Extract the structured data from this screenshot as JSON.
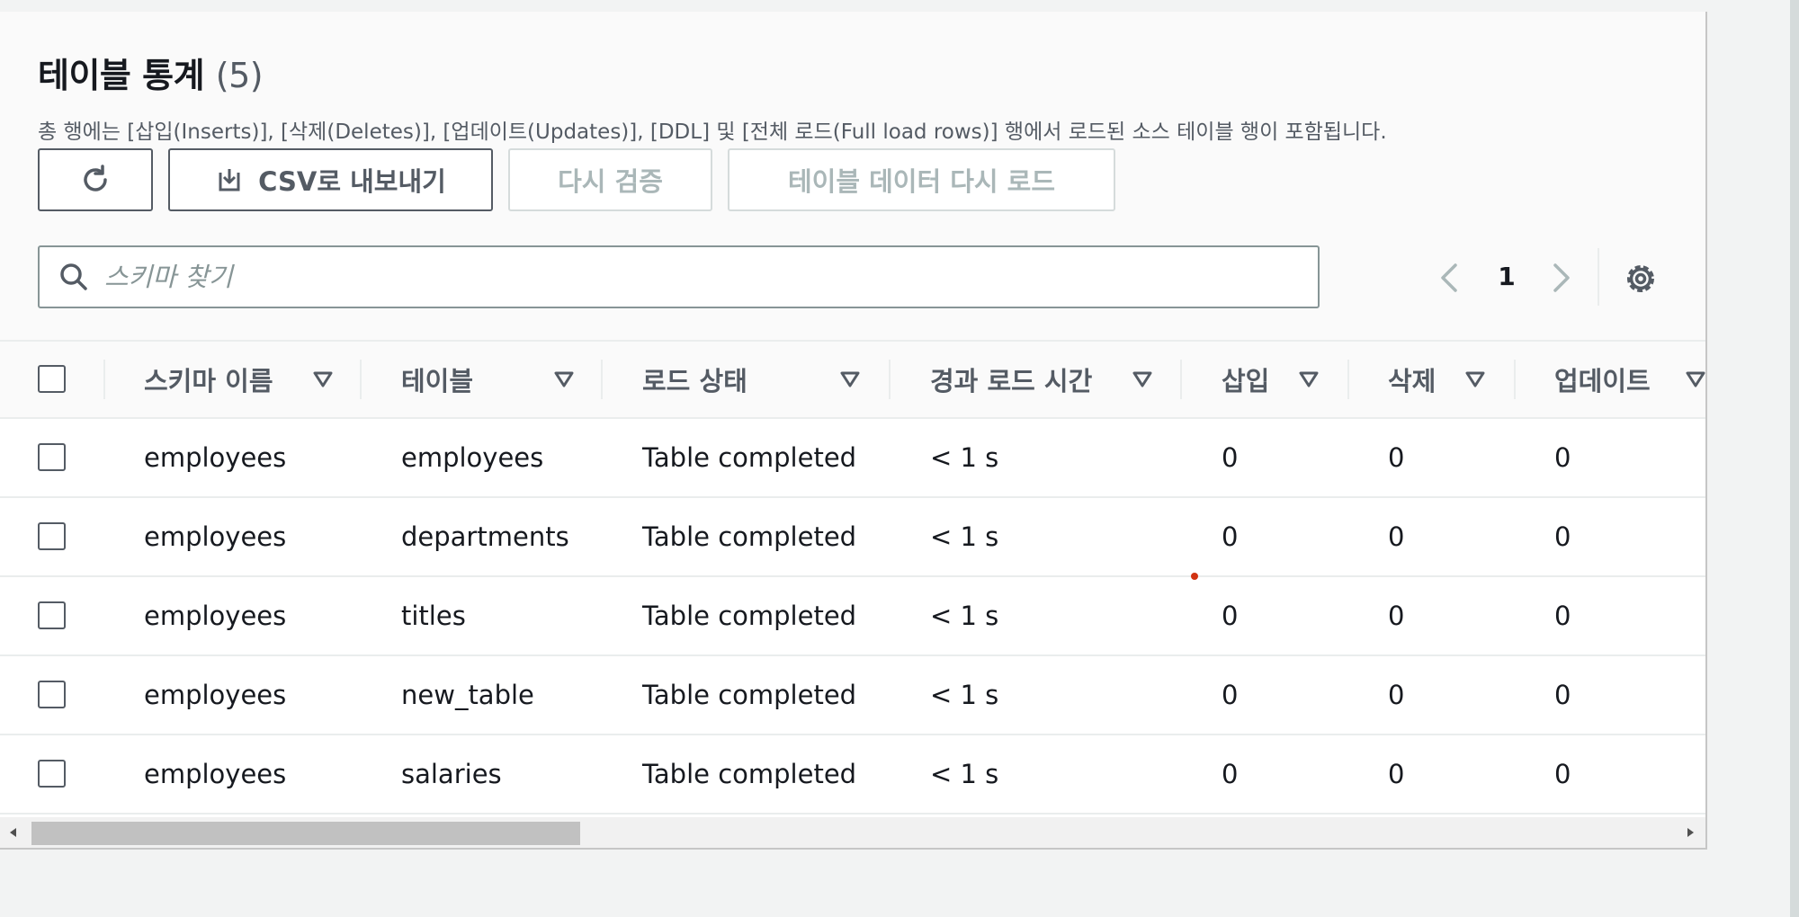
{
  "panel": {
    "title": "테이블 통계",
    "count": "(5)",
    "description": "총 행에는 [삽입(Inserts)], [삭제(Deletes)], [업데이트(Updates)], [DDL] 및 [전체 로드(Full load rows)] 행에서 로드된 소스 테이블 행이 포함됩니다."
  },
  "toolbar": {
    "refresh_icon": "refresh-icon",
    "export_label": "CSV로 내보내기",
    "export_icon": "download-icon",
    "revalidate_label": "다시 검증",
    "reload_label": "테이블 데이터 다시 로드"
  },
  "search": {
    "placeholder": "스키마 찾기",
    "value": ""
  },
  "pagination": {
    "current_page": "1"
  },
  "table": {
    "columns": [
      "스키마 이름",
      "테이블",
      "로드 상태",
      "경과 로드 시간",
      "삽입",
      "삭제",
      "업데이트"
    ],
    "rows": [
      [
        "employees",
        "employees",
        "Table completed",
        "< 1 s",
        "0",
        "0",
        "0"
      ],
      [
        "employees",
        "departments",
        "Table completed",
        "< 1 s",
        "0",
        "0",
        "0"
      ],
      [
        "employees",
        "titles",
        "Table completed",
        "< 1 s",
        "0",
        "0",
        "0"
      ],
      [
        "employees",
        "new_table",
        "Table completed",
        "< 1 s",
        "0",
        "0",
        "0"
      ],
      [
        "employees",
        "salaries",
        "Table completed",
        "< 1 s",
        "0",
        "0",
        "0"
      ]
    ]
  },
  "colors": {
    "text": "#16191f",
    "muted": "#545b64",
    "disabled": "#aab7b8",
    "border": "#eaeded",
    "accent_dot": "#d13212"
  }
}
